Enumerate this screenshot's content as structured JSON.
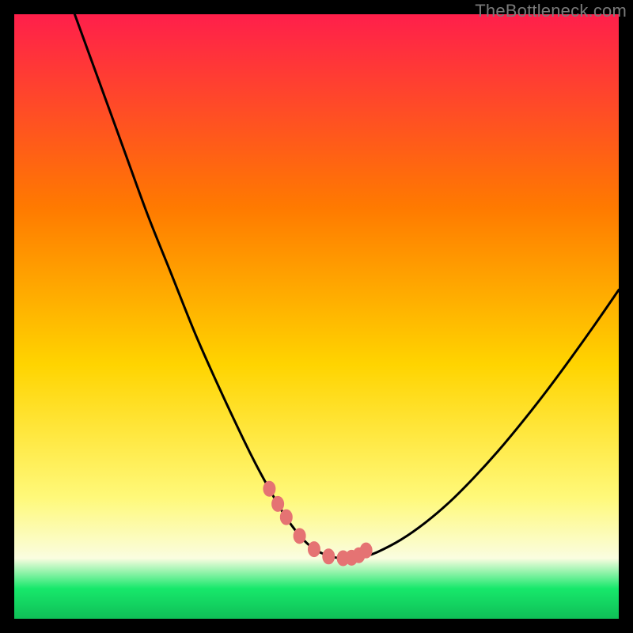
{
  "watermark": "TheBottleneck.com",
  "colors": {
    "bg": "#000000",
    "curve": "#000000",
    "marker_fill": "#e57373",
    "marker_stroke": "#e57373",
    "gradient_top": "#ff1f4b",
    "gradient_mid_upper": "#ff7a00",
    "gradient_mid": "#ffd400",
    "gradient_lower_yellow": "#fff97a",
    "gradient_pale": "#fafde0",
    "gradient_green": "#17e86b",
    "gradient_bottom": "#0fbf57"
  },
  "chart_data": {
    "type": "line",
    "title": "",
    "xlabel": "",
    "ylabel": "",
    "xlim": [
      0,
      100
    ],
    "ylim": [
      0,
      100
    ],
    "grid": false,
    "legend": false,
    "annotations": [],
    "series": [
      {
        "name": "bottleneck-curve",
        "x": [
          10,
          14,
          18,
          22,
          26,
          30,
          34,
          38,
          40,
          42,
          44,
          45,
          46,
          47,
          48,
          49,
          50,
          51,
          52,
          53,
          54,
          55,
          56,
          58,
          60,
          64,
          68,
          72,
          76,
          80,
          84,
          88,
          92,
          96,
          100
        ],
        "y": [
          100,
          89,
          78,
          67,
          57,
          47,
          38,
          29.5,
          25.5,
          21.8,
          18.3,
          16.7,
          15.3,
          14,
          12.9,
          12,
          11.3,
          10.8,
          10.4,
          10.15,
          10.02,
          10.0,
          10.05,
          10.35,
          11,
          13.1,
          15.9,
          19.3,
          23.3,
          27.7,
          32.5,
          37.6,
          43,
          48.6,
          54.4
        ]
      }
    ],
    "markers": {
      "name": "highlight-markers",
      "x": [
        42.2,
        43.6,
        45.0,
        47.2,
        49.6,
        52.0,
        54.4,
        55.8,
        57.0,
        58.2
      ],
      "y": [
        21.5,
        19.0,
        16.8,
        13.7,
        11.5,
        10.3,
        10.02,
        10.1,
        10.5,
        11.3
      ]
    }
  }
}
